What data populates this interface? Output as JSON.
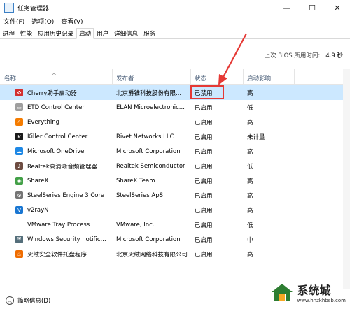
{
  "window": {
    "title": "任务管理器",
    "controls": [
      "—",
      "☐",
      "✕"
    ]
  },
  "menu": [
    "文件(F)",
    "选项(O)",
    "查看(V)"
  ],
  "tabs": [
    {
      "label": "进程",
      "active": false
    },
    {
      "label": "性能",
      "active": false
    },
    {
      "label": "应用历史记录",
      "active": false
    },
    {
      "label": "启动",
      "active": true
    },
    {
      "label": "用户",
      "active": false
    },
    {
      "label": "详细信息",
      "active": false
    },
    {
      "label": "服务",
      "active": false
    }
  ],
  "bios": {
    "label": "上次 BIOS 所用时间:",
    "value": "4.9 秒"
  },
  "columns": {
    "name": "名称",
    "publisher": "发布者",
    "status": "状态",
    "impact": "启动影响"
  },
  "rows": [
    {
      "name": "Cherry助手启动器",
      "publisher": "北京爵锥科技股份有限...",
      "status": "已禁用",
      "impact": "高",
      "icon": "cherry-icon",
      "color": "#d32f2f",
      "glyph": "✿"
    },
    {
      "name": "ETD Control Center",
      "publisher": "ELAN Microelectronic...",
      "status": "已启用",
      "impact": "低",
      "icon": "etd-icon",
      "color": "#9e9e9e",
      "glyph": "▭"
    },
    {
      "name": "Everything",
      "publisher": "",
      "status": "已启用",
      "impact": "高",
      "icon": "everything-icon",
      "color": "#f57c00",
      "glyph": "⌕"
    },
    {
      "name": "Killer Control Center",
      "publisher": "Rivet Networks LLC",
      "status": "已启用",
      "impact": "未计量",
      "icon": "killer-icon",
      "color": "#1a1a1a",
      "glyph": "K"
    },
    {
      "name": "Microsoft OneDrive",
      "publisher": "Microsoft Corporation",
      "status": "已启用",
      "impact": "高",
      "icon": "onedrive-icon",
      "color": "#1e88e5",
      "glyph": "☁"
    },
    {
      "name": "Realtek高清晰音频管理器",
      "publisher": "Realtek Semiconductor",
      "status": "已启用",
      "impact": "低",
      "icon": "realtek-icon",
      "color": "#6d4c41",
      "glyph": "♪"
    },
    {
      "name": "ShareX",
      "publisher": "ShareX Team",
      "status": "已启用",
      "impact": "高",
      "icon": "sharex-icon",
      "color": "#43a047",
      "glyph": "◉"
    },
    {
      "name": "SteelSeries Engine 3 Core",
      "publisher": "SteelSeries ApS",
      "status": "已启用",
      "impact": "高",
      "icon": "steelseries-icon",
      "color": "#757575",
      "glyph": "⚙"
    },
    {
      "name": "v2rayN",
      "publisher": "",
      "status": "已启用",
      "impact": "高",
      "icon": "v2rayn-icon",
      "color": "#1976d2",
      "glyph": "V"
    },
    {
      "name": "VMware Tray Process",
      "publisher": "VMware, Inc.",
      "status": "已启用",
      "impact": "低",
      "icon": "vmware-icon",
      "color": "#ffffff",
      "glyph": ""
    },
    {
      "name": "Windows Security notific...",
      "publisher": "Microsoft Corporation",
      "status": "已启用",
      "impact": "中",
      "icon": "windows-security-icon",
      "color": "#546e7a",
      "glyph": "⛨"
    },
    {
      "name": "火绒安全软件托盘程序",
      "publisher": "北京火绒网络科技有限公司",
      "status": "已启用",
      "impact": "高",
      "icon": "huorong-icon",
      "color": "#ef6c00",
      "glyph": "♨"
    }
  ],
  "footer": {
    "label": "简略信息(D)"
  },
  "watermark": {
    "main": "系统城",
    "sub": "www.hnzkhbsb.com"
  }
}
